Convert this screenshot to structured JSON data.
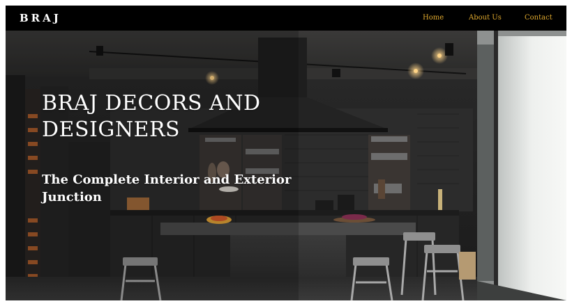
{
  "brand": {
    "logo_text": "BRAJ"
  },
  "nav": {
    "items": [
      {
        "label": "Home"
      },
      {
        "label": "About Us"
      },
      {
        "label": "Contact"
      }
    ]
  },
  "hero": {
    "title": "BRAJ DECORS AND DESIGNERS",
    "subtitle": "The Complete Interior and Exterior Junction",
    "background": "dark-modern-kitchen-photo"
  },
  "colors": {
    "nav_background": "#000000",
    "nav_link": "#e0a92e",
    "logo": "#ffffff",
    "hero_text": "#ffffff"
  }
}
